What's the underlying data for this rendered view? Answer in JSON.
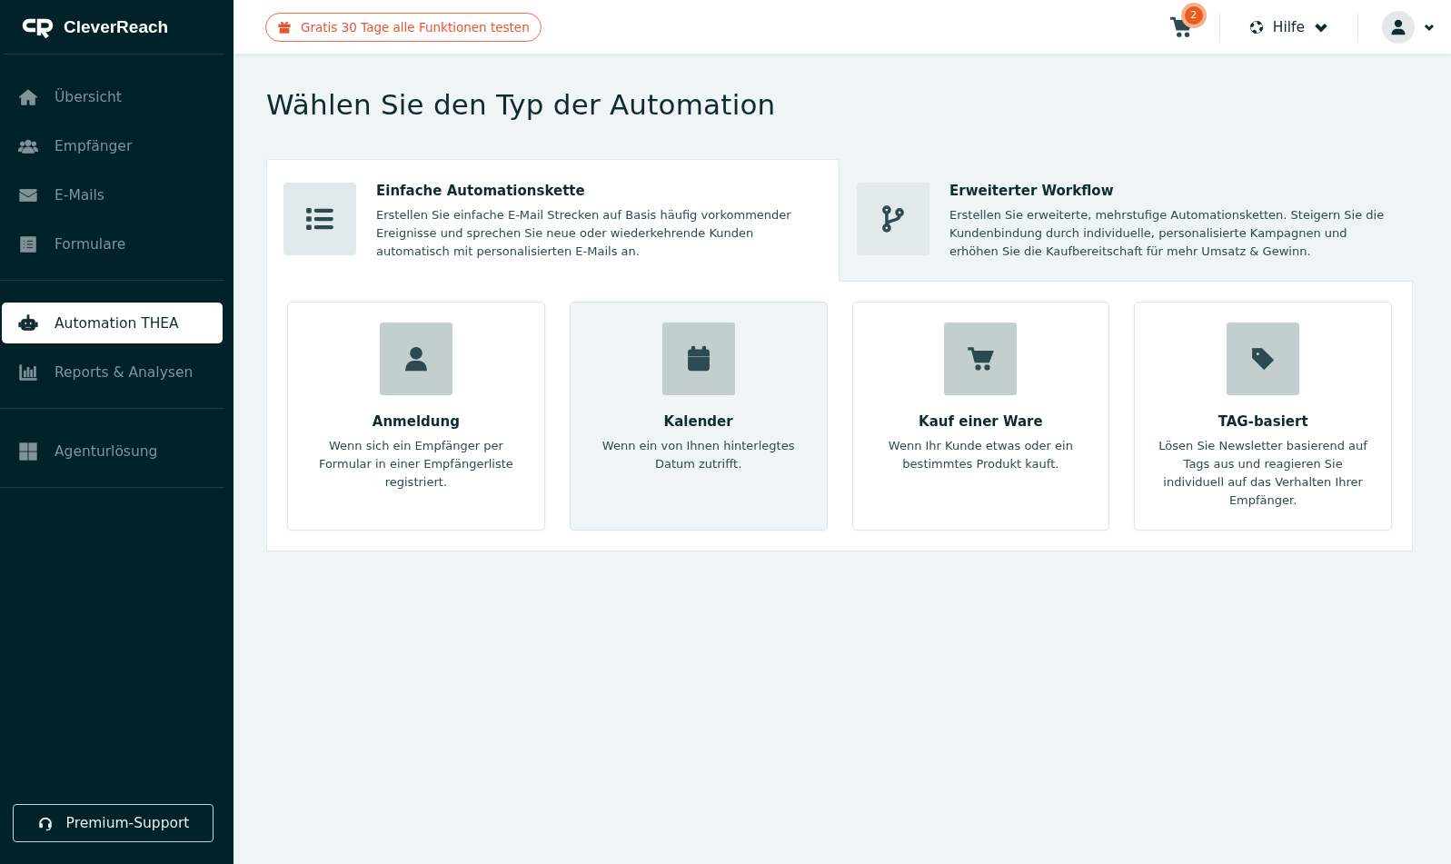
{
  "sidebar": {
    "logo": "CleverReach",
    "groups": [
      {
        "items": [
          {
            "label": "Übersicht",
            "kind": "home",
            "selected": false
          },
          {
            "label": "Empfänger",
            "kind": "users",
            "selected": false
          },
          {
            "label": "E-Mails",
            "kind": "mail",
            "selected": false
          },
          {
            "label": "Formulare",
            "kind": "form",
            "selected": false
          }
        ]
      },
      {
        "items": [
          {
            "label": "Automation THEA",
            "kind": "robot",
            "selected": true
          },
          {
            "label": "Reports & Analysen",
            "kind": "chart",
            "selected": false
          }
        ]
      },
      {
        "items": [
          {
            "label": "Agenturlösung",
            "kind": "grid",
            "selected": false
          }
        ]
      }
    ],
    "support_button": "Premium-Support"
  },
  "header": {
    "trial_button": "Gratis 30 Tage alle Funktionen testen",
    "cart_count": "2",
    "help": "Hilfe"
  },
  "title": "Wählen Sie den Typ der Automation",
  "tabs": [
    {
      "title": "Einfache Automationskette",
      "kind": "list",
      "description": "Erstellen Sie einfache E-Mail Strecken auf Basis häufig vorkommender Ereignisse und sprechen Sie neue oder wiederkehrende Kunden automatisch mit personalisierten E-Mails an.",
      "selected": true
    },
    {
      "title": "Erweiterter Workflow",
      "kind": "branch",
      "description": "Erstellen Sie erweiterte, mehrstufige Automationsketten. Steigern Sie die Kundenbindung durch individuelle, personalisierte Kampagnen und erhöhen Sie die Kaufbereitschaft für mehr Umsatz & Gewinn.",
      "selected": false
    }
  ],
  "triggers": [
    {
      "title": "Anmeldung",
      "kind": "user",
      "description": "Wenn sich ein Empfänger per Formular in einer Empfängerliste registriert.",
      "selected": false
    },
    {
      "title": "Kalender",
      "kind": "calendar",
      "description": "Wenn ein von Ihnen hinterlegtes Datum zutrifft.",
      "selected": true
    },
    {
      "title": "Kauf einer Ware",
      "kind": "cart",
      "description": "Wenn Ihr Kunde etwas oder ein bestimmtes Produkt kauft.",
      "selected": false
    },
    {
      "title": "TAG-basiert",
      "kind": "tag",
      "description": "Lösen Sie Newsletter basierend auf Tags aus und reagieren Sie individuell auf das Verhalten Ihrer Empfänger.",
      "selected": false
    }
  ]
}
